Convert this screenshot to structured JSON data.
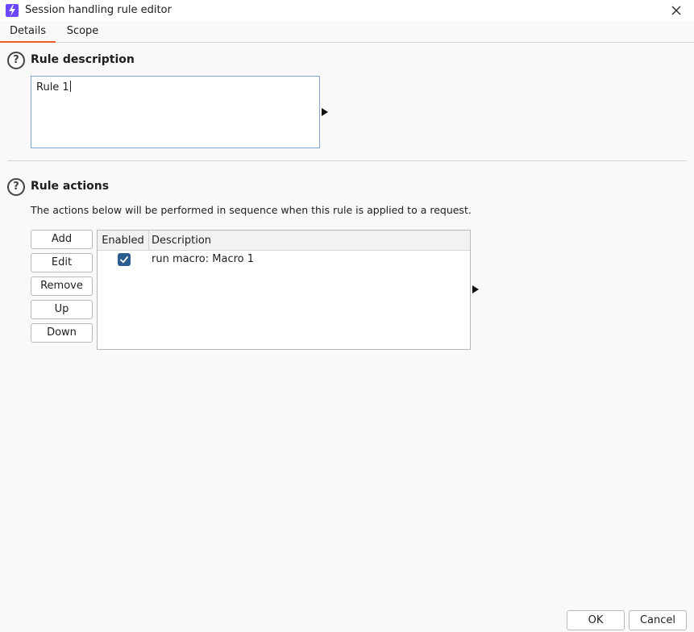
{
  "window": {
    "title": "Session handling rule editor",
    "app_icon": "lightning-icon",
    "close_icon": "close-icon"
  },
  "tabs": [
    {
      "label": "Details",
      "active": true
    },
    {
      "label": "Scope",
      "active": false
    }
  ],
  "rule_description": {
    "heading": "Rule description",
    "value": "Rule 1",
    "help_icon": "question-icon"
  },
  "rule_actions": {
    "heading": "Rule actions",
    "help_icon": "question-icon",
    "description": "The actions below will be performed in sequence when this rule is applied to a request.",
    "buttons": [
      "Add",
      "Edit",
      "Remove",
      "Up",
      "Down"
    ],
    "table": {
      "columns": [
        "Enabled",
        "Description"
      ],
      "rows": [
        {
          "enabled": true,
          "description": "run macro: Macro 1"
        }
      ]
    }
  },
  "footer": {
    "ok_label": "OK",
    "cancel_label": "Cancel"
  },
  "colors": {
    "accent": "#e8612c",
    "brand": "#6b48ff",
    "checkbox": "#2c5d8f",
    "focus_border": "#7aa7d6"
  }
}
